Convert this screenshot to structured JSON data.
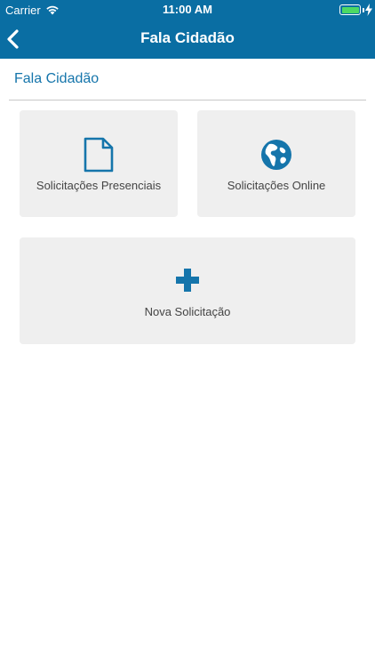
{
  "status_bar": {
    "carrier": "Carrier",
    "time": "11:00 AM",
    "battery_color": "#4cd964"
  },
  "nav": {
    "title": "Fala Cidadão",
    "back_icon": "chevron-left-icon",
    "background": "#0a6ea3"
  },
  "section": {
    "title": "Fala Cidadão"
  },
  "cards": [
    {
      "label": "Solicitações Presenciais",
      "icon": "document-icon"
    },
    {
      "label": "Solicitações Online",
      "icon": "globe-icon"
    },
    {
      "label": "Nova Solicitação",
      "icon": "plus-icon"
    }
  ],
  "accent_color": "#1575ab"
}
